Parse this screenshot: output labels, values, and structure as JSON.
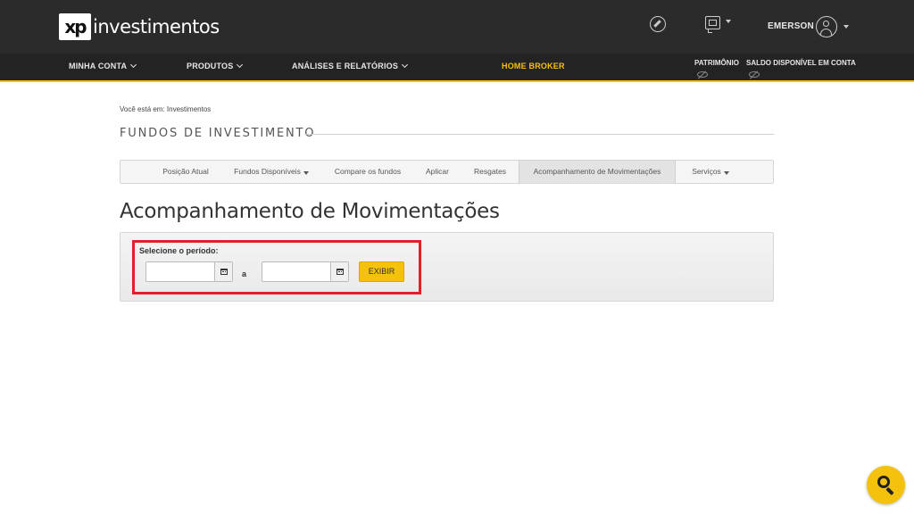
{
  "brand": {
    "mark": "xp",
    "name": "investimentos"
  },
  "header": {
    "user_name": "EMERSON"
  },
  "nav": {
    "minha_conta": "MINHA CONTA",
    "produtos": "PRODUTOS",
    "analises": "ANÁLISES E RELATÓRIOS",
    "home_broker": "HOME BROKER",
    "patrimonio": "PATRIMÔNIO",
    "saldo": "SALDO DISPONÍVEL EM CONTA"
  },
  "breadcrumb": "Você está em: Investimentos",
  "section_title": "FUNDOS DE INVESTIMENTO",
  "tabs": [
    {
      "label": "Posição Atual"
    },
    {
      "label": "Fundos Disponíveis"
    },
    {
      "label": "Compare os fundos"
    },
    {
      "label": "Aplicar"
    },
    {
      "label": "Resgates"
    },
    {
      "label": "Acompanhamento de Movimentações"
    },
    {
      "label": "Serviços"
    }
  ],
  "active_tab": "Acompanhamento de Movimentações",
  "page_heading": "Acompanhamento de Movimentações",
  "filter": {
    "period_label": "Selecione o período:",
    "start_date": "",
    "end_date": "",
    "separator": "a",
    "submit_label": "EXIBIR"
  },
  "colors": {
    "accent": "#f4c20d",
    "topbar": "#2b2b2b",
    "highlight": "#e3202a"
  },
  "icons": [
    "compass-icon",
    "chat-icon",
    "user-icon",
    "eye-hidden-icon",
    "calendar-icon",
    "search-icon"
  ]
}
